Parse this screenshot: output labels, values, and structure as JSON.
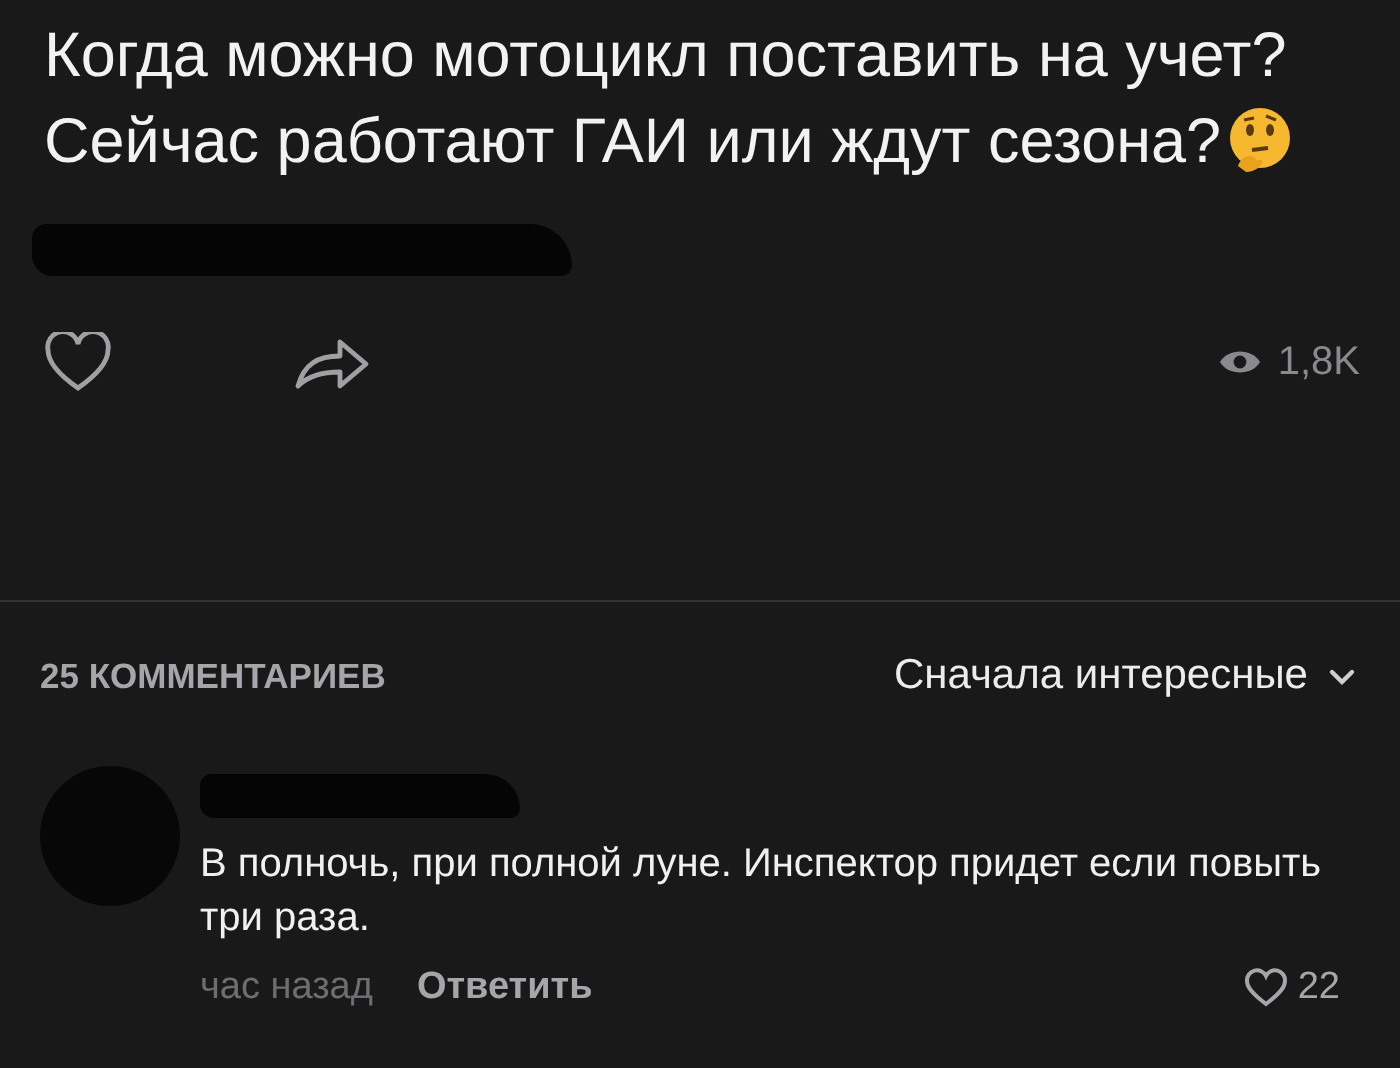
{
  "post": {
    "title_paragraphs": [
      "Когда можно мотоцикл поставить на учет?",
      "Сейчас работают ГАИ или ждут сезона?"
    ],
    "views": "1,8K"
  },
  "comments": {
    "count_label": "25 КОММЕНТАРИЕВ",
    "sort_label": "Сначала интересные",
    "items": [
      {
        "text": "В полночь, при полной луне. Инспектор придет если повыть три раза.",
        "time": "час назад",
        "reply": "Ответить",
        "likes": "22"
      }
    ]
  }
}
